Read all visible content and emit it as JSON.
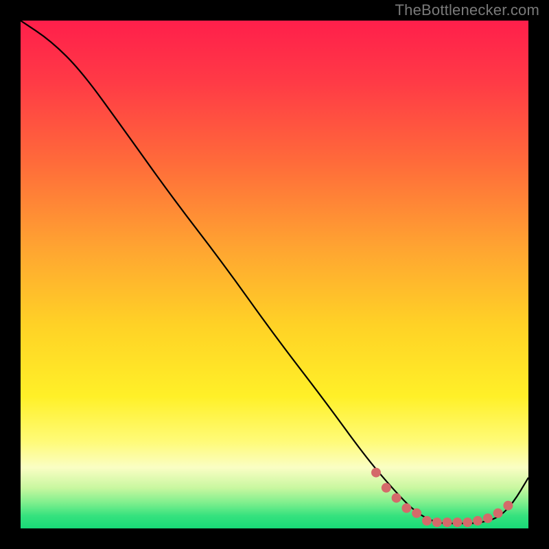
{
  "watermark": "TheBottlenecker.com",
  "chart_data": {
    "type": "line",
    "title": "",
    "xlabel": "",
    "ylabel": "",
    "xlim": [
      0,
      1
    ],
    "ylim": [
      0,
      1
    ],
    "series": [
      {
        "name": "bottleneck-curve",
        "x": [
          0.0,
          0.06,
          0.12,
          0.2,
          0.3,
          0.4,
          0.5,
          0.6,
          0.68,
          0.74,
          0.78,
          0.82,
          0.86,
          0.9,
          0.94,
          0.97,
          1.0
        ],
        "y": [
          1.0,
          0.96,
          0.9,
          0.79,
          0.65,
          0.52,
          0.38,
          0.25,
          0.14,
          0.07,
          0.03,
          0.01,
          0.01,
          0.01,
          0.02,
          0.05,
          0.1
        ]
      }
    ],
    "markers": {
      "name": "highlight-dots",
      "color": "#d46a6a",
      "x": [
        0.7,
        0.72,
        0.74,
        0.76,
        0.78,
        0.8,
        0.82,
        0.84,
        0.86,
        0.88,
        0.9,
        0.92,
        0.94,
        0.96
      ],
      "y": [
        0.11,
        0.08,
        0.06,
        0.04,
        0.03,
        0.015,
        0.012,
        0.012,
        0.012,
        0.012,
        0.015,
        0.02,
        0.03,
        0.045
      ]
    },
    "gradient_stops": [
      {
        "pos": 0.0,
        "color": "#ff1f4b"
      },
      {
        "pos": 0.5,
        "color": "#ffd226"
      },
      {
        "pos": 0.85,
        "color": "#fffb79"
      },
      {
        "pos": 1.0,
        "color": "#18d977"
      }
    ]
  }
}
